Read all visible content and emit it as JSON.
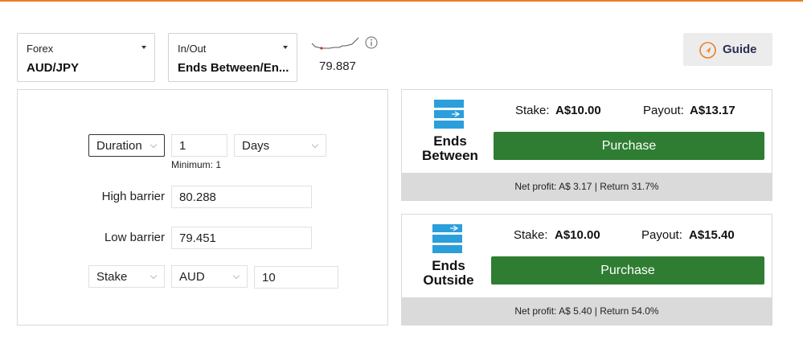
{
  "colors": {
    "accent": "#e98024",
    "purchase": "#2e7d32",
    "icon_blue": "#2a9fdc"
  },
  "market_selector": {
    "category": "Forex",
    "name": "AUD/JPY"
  },
  "trade_type_selector": {
    "category": "In/Out",
    "name": "Ends Between/En..."
  },
  "spot": {
    "value": "79.887",
    "trend_icon": "sparkline-icon",
    "info_icon": "info-icon"
  },
  "guide": {
    "label": "Guide",
    "icon": "play-icon"
  },
  "form": {
    "duration_type": "Duration",
    "duration_value": "1",
    "duration_unit": "Days",
    "minimum_note": "Minimum: 1",
    "high_barrier_label": "High barrier",
    "high_barrier_value": "80.288",
    "low_barrier_label": "Low barrier",
    "low_barrier_value": "79.451",
    "amount_type": "Stake",
    "currency": "AUD",
    "amount_value": "10"
  },
  "contracts": [
    {
      "name_line1": "Ends",
      "name_line2": "Between",
      "stake_label": "Stake:",
      "stake": "A$10.00",
      "payout_label": "Payout:",
      "payout": "A$13.17",
      "purchase_label": "Purchase",
      "net_profit": "Net profit:  A$ 3.17 | Return 31.7%"
    },
    {
      "name_line1": "Ends",
      "name_line2": "Outside",
      "stake_label": "Stake:",
      "stake": "A$10.00",
      "payout_label": "Payout:",
      "payout": "A$15.40",
      "purchase_label": "Purchase",
      "net_profit": "Net profit:  A$ 5.40 | Return 54.0%"
    }
  ]
}
